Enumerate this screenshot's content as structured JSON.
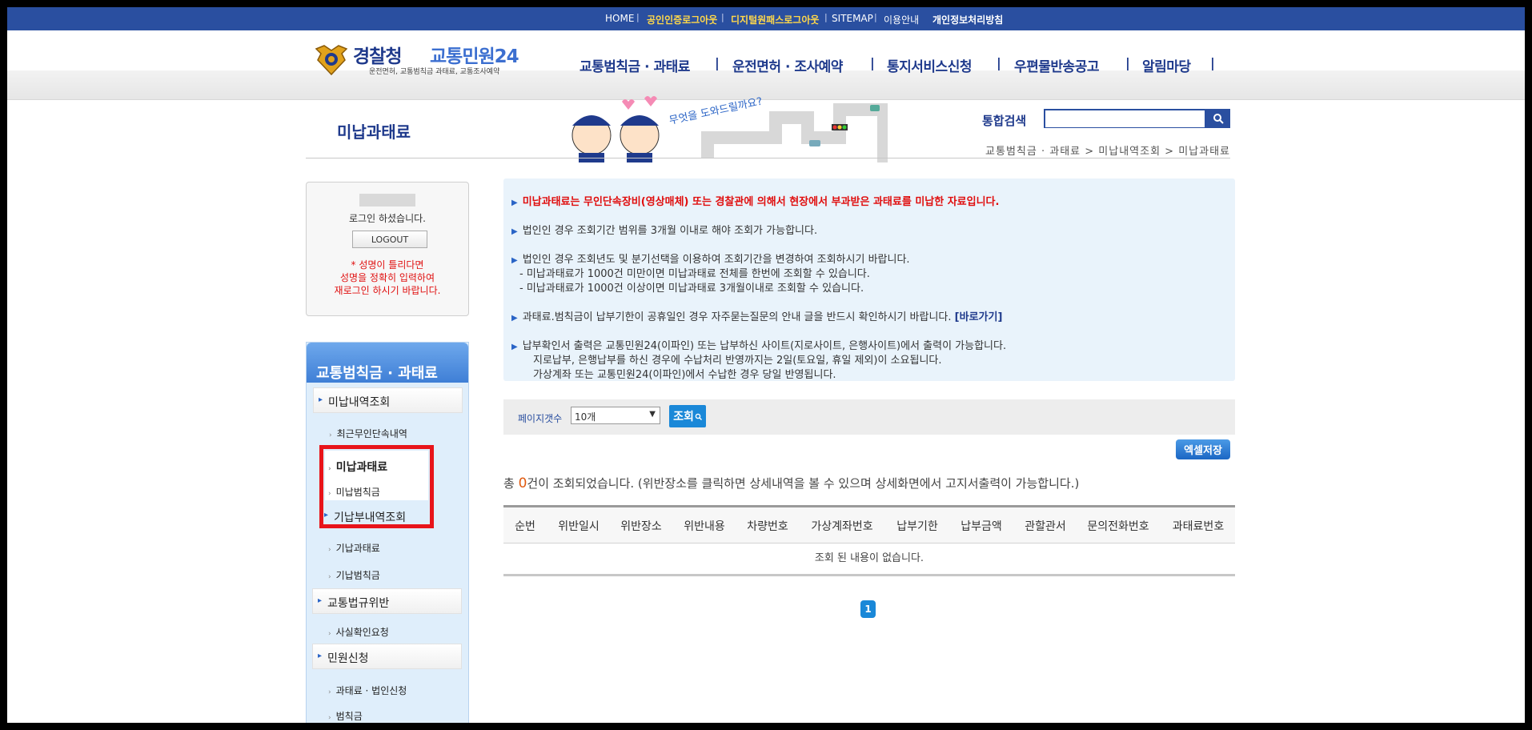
{
  "topbar": {
    "home": "HOME",
    "cert_login": "공인인증로그아웃",
    "digital_login": "디지털원패스로그아웃",
    "sitemap": "SITEMAP",
    "usage": "이용안내",
    "privacy": "개인정보처리방침",
    "sep": "|"
  },
  "header": {
    "logo_part1": "경찰청",
    "logo_part2": "교통민원24",
    "logo_sub": "운전면허, 교통범칙금 과태료, 교통조사예약",
    "nav": [
      "교통범칙금 · 과태료",
      "운전면허 · 조사예약",
      "통지서비스신청",
      "우편물반송공고",
      "알림마당"
    ],
    "nav_sep": "|"
  },
  "page": {
    "title": "미납과태료",
    "search_label": "통합검색",
    "search_placeholder": "",
    "breadcrumb": "교통범칙금 · 과태료 > 미납내역조회 > 미납과태료",
    "banner_text": "무엇을 도와드릴까요?"
  },
  "login": {
    "message": "로그인 하셨습니다.",
    "logout": "LOGOUT",
    "warning": [
      "* 성명이 틀리다면",
      "성명을 정확히 입력하여",
      "재로그인 하시기 바랍니다."
    ]
  },
  "lnb": {
    "title": "교통범칙금 · 과태료",
    "groups": [
      {
        "label": "미납내역조회",
        "subs": [
          "최근무인단속내역",
          "미납과태료",
          "미납범칙금"
        ]
      },
      {
        "label": "기납부내역조회",
        "subs": [
          "기납과태료",
          "기납범칙금"
        ]
      },
      {
        "label": "교통법규위반",
        "subs": [
          "사실확인요청"
        ]
      },
      {
        "label": "민원신청",
        "subs": [
          "과태료 · 법인신청",
          "범칙금"
        ]
      }
    ]
  },
  "notice": {
    "line1": "미납과태료는 무인단속장비(영상매체) 또는 경찰관에 의해서 현장에서 부과받은 과태료를 미납한 자료입니다.",
    "line2": "법인인 경우 조회기간 범위를 3개월 이내로 해야 조회가 가능합니다.",
    "line3": "법인인 경우 조회년도 및 분기선택을 이용하여 조회기간을 변경하여 조회하시기 바랍니다.",
    "line3a": "- 미납과태료가 1000건 미만이면 미납과태료 전체를 한번에 조회할 수 있습니다.",
    "line3b": "- 미납과태료가 1000건 이상이면 미납과태료 3개월이내로 조회할 수 있습니다.",
    "line4": "과태료.범칙금이 납부기한이 공휴일인 경우 자주묻는질문의 안내 글을 반드시 확인하시기 바랍니다.",
    "line4_link": "[바로가기]",
    "line5": "납부확인서 출력은 교통민원24(이파인) 또는 납부하신 사이트(지로사이트, 은행사이트)에서 출력이 가능합니다.",
    "line5a": "지로납부, 은행납부를 하신 경우에 수납처리 반영까지는 2일(토요일, 휴일 제외)이 소요됩니다.",
    "line5b": "가상계좌 또는 교통민원24(이파인)에서 수납한 경우 당일 반영됩니다."
  },
  "options": {
    "page_count_label": "페이지갯수",
    "page_count_value": "10개",
    "query_button": "조회",
    "excel_button": "엑셀저장"
  },
  "result": {
    "prefix": "총 ",
    "count": "0",
    "suffix": "건이 조회되었습니다. (위반장소를 클릭하면 상세내역을 볼 수 있으며 상세화면에서 고지서출력이 가능합니다.)"
  },
  "table": {
    "columns": [
      "순번",
      "위반일시",
      "위반장소",
      "위반내용",
      "차량번호",
      "가상계좌번호",
      "납부기한",
      "납부금액",
      "관할관서",
      "문의전화번호",
      "과태료번호"
    ],
    "empty": "조회 된 내용이 없습니다."
  },
  "pagination": {
    "current": "1"
  },
  "colors": {
    "brand_blue": "#2a4fa0",
    "accent_blue": "#1a88d8",
    "highlight_red": "#e8141a",
    "notice_red": "#e00d0d"
  }
}
